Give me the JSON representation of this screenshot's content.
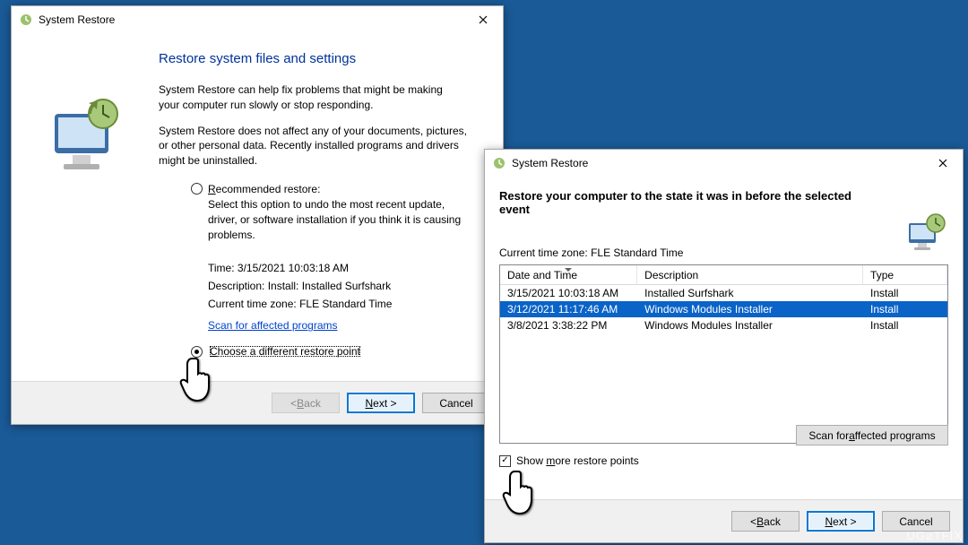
{
  "watermark": "UG⌀TFIX",
  "window1": {
    "title": "System Restore",
    "heading": "Restore system files and settings",
    "intro1": "System Restore can help fix problems that might be making your computer run slowly or stop responding.",
    "intro2": "System Restore does not affect any of your documents, pictures, or other personal data. Recently installed programs and drivers might be uninstalled.",
    "options": {
      "recommended": {
        "label": "Recommended restore:",
        "desc": "Select this option to undo the most recent update, driver, or software installation if you think it is causing problems.",
        "time_label": "Time:",
        "time": "3/15/2021 10:03:18 AM",
        "desc_label": "Description:",
        "desc_val": "Install: Installed Surfshark",
        "tz_label": "Current time zone:",
        "tz": "FLE Standard Time",
        "scan_link": "Scan for affected programs"
      },
      "choose": {
        "label": "Choose a different restore point"
      }
    },
    "buttons": {
      "back": "< Back",
      "next": "Next >",
      "cancel": "Cancel"
    }
  },
  "window2": {
    "title": "System Restore",
    "heading": "Restore your computer to the state it was in before the selected event",
    "tz_label": "Current time zone:",
    "tz": "FLE Standard Time",
    "columns": {
      "date": "Date and Time",
      "desc": "Description",
      "type": "Type"
    },
    "rows": [
      {
        "date": "3/15/2021 10:03:18 AM",
        "desc": "Installed Surfshark",
        "type": "Install",
        "selected": false
      },
      {
        "date": "3/12/2021 11:17:46 AM",
        "desc": "Windows Modules Installer",
        "type": "Install",
        "selected": true
      },
      {
        "date": "3/8/2021 3:38:22 PM",
        "desc": "Windows Modules Installer",
        "type": "Install",
        "selected": false
      }
    ],
    "show_more": "Show more restore points",
    "scan_btn": "Scan for affected programs",
    "buttons": {
      "back": "< Back",
      "next": "Next >",
      "cancel": "Cancel"
    }
  }
}
